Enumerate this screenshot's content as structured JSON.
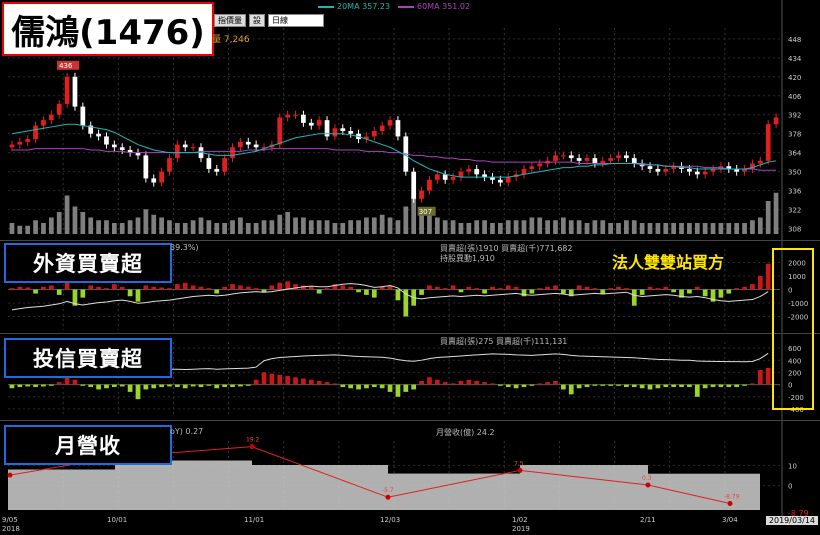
{
  "title": "儒鴻(1476)",
  "toolbar": {
    "b1": "指價量",
    "b2": "設",
    "period": "日線"
  },
  "legend": {
    "ma20": "20MA 357.23",
    "ma60": "60MA 351.02",
    "ma20_color": "#1fb5b5",
    "ma60_color": "#b040c0"
  },
  "volume_text": "量 7,246",
  "labels": {
    "foreign": "外資買賣超",
    "trust": "投信買賣超",
    "revenue": "月營收"
  },
  "annotation": "法人雙雙站買方",
  "foreign_info": {
    "pct": "39.3%)",
    "line1": "買賣超(張)1910 買賣超(千)771,682",
    "line2": "持股異動1,910"
  },
  "trust_info": {
    "line1": "買賣超(張)275 買賣超(千)111,131"
  },
  "rev_info": {
    "yoy": "oY) 0.27",
    "rev": "月營收(億) 24.2"
  },
  "price_peak_label": "436",
  "price_low_label": "307",
  "last_value": "-8.79",
  "date_label": "2019/03/14",
  "x_ticks": [
    {
      "label": "9/05",
      "sub": "2018",
      "x": 10
    },
    {
      "label": "10/01",
      "sub": "",
      "x": 115
    },
    {
      "label": "11/01",
      "sub": "",
      "x": 252
    },
    {
      "label": "12/03",
      "sub": "",
      "x": 388
    },
    {
      "label": "1/02",
      "sub": "2019",
      "x": 520
    },
    {
      "label": "2/11",
      "sub": "",
      "x": 648
    },
    {
      "label": "3/04",
      "sub": "",
      "x": 730
    }
  ],
  "colors": {
    "up": "#e02020",
    "down": "#ffffff",
    "foreign_pos": "#c81818",
    "foreign_neg": "#9bd42a",
    "volume": "#7f7f7f"
  },
  "chart_data": [
    {
      "type": "candlestick",
      "title": "儒鴻(1476)",
      "yticks": [
        308,
        322,
        336,
        350,
        364,
        378,
        392,
        406,
        420,
        434,
        448
      ],
      "ylim": [
        304,
        456
      ],
      "close": [
        370,
        372,
        374,
        384,
        388,
        392,
        400,
        420,
        398,
        384,
        378,
        376,
        370,
        368,
        366,
        364,
        362,
        345,
        342,
        350,
        360,
        370,
        368,
        368,
        360,
        352,
        350,
        360,
        368,
        372,
        370,
        368,
        368,
        370,
        390,
        392,
        392,
        386,
        384,
        388,
        376,
        382,
        380,
        378,
        374,
        376,
        380,
        384,
        388,
        376,
        350,
        330,
        336,
        344,
        348,
        344,
        346,
        350,
        352,
        348,
        346,
        344,
        342,
        346,
        348,
        352,
        354,
        356,
        358,
        362,
        362,
        360,
        358,
        360,
        356,
        358,
        360,
        362,
        360,
        356,
        354,
        352,
        350,
        352,
        354,
        352,
        350,
        348,
        350,
        352,
        354,
        352,
        350,
        352,
        356,
        358,
        385,
        390
      ],
      "ma20": [
        378,
        379,
        380,
        381,
        382,
        383,
        384,
        385,
        385,
        384,
        383,
        382,
        381,
        379,
        376,
        373,
        370,
        368,
        366,
        365,
        364,
        364,
        364,
        364,
        364,
        363,
        362,
        362,
        362,
        363,
        364,
        365,
        367,
        369,
        371,
        373,
        375,
        376,
        377,
        378,
        378,
        378,
        378,
        377,
        376,
        374,
        372,
        370,
        368,
        365,
        362,
        358,
        355,
        352,
        350,
        348,
        347,
        346,
        346,
        346,
        346,
        346,
        346,
        346,
        347,
        348,
        349,
        350,
        351,
        352,
        353,
        353,
        354,
        354,
        355,
        355,
        356,
        356,
        356,
        356,
        356,
        355,
        355,
        354,
        354,
        353,
        353,
        352,
        352,
        352,
        352,
        352,
        352,
        352,
        353,
        355,
        357,
        358
      ],
      "ma60": [
        366,
        366,
        366,
        367,
        367,
        367,
        367,
        367,
        367,
        367,
        366,
        366,
        365,
        365,
        365,
        364,
        364,
        364,
        364,
        364,
        364,
        364,
        364,
        364,
        365,
        365,
        365,
        365,
        365,
        365,
        366,
        366,
        366,
        367,
        367,
        367,
        367,
        367,
        367,
        367,
        367,
        366,
        366,
        366,
        366,
        365,
        365,
        365,
        364,
        364,
        363,
        362,
        362,
        361,
        361,
        360,
        360,
        359,
        359,
        358,
        358,
        357,
        357,
        357,
        357,
        357,
        357,
        357,
        357,
        357,
        357,
        357,
        356,
        356,
        356,
        356,
        356,
        356,
        356,
        356,
        355,
        355,
        355,
        354,
        354,
        354,
        354,
        354,
        353,
        353,
        353,
        352,
        352,
        352,
        352,
        351,
        351,
        351
      ],
      "volume": [
        4,
        3,
        3,
        5,
        4,
        6,
        8,
        14,
        10,
        8,
        6,
        5,
        5,
        4,
        4,
        5,
        6,
        9,
        7,
        6,
        5,
        4,
        4,
        5,
        6,
        5,
        4,
        4,
        5,
        6,
        4,
        4,
        5,
        5,
        7,
        8,
        6,
        6,
        5,
        5,
        5,
        4,
        4,
        5,
        5,
        6,
        6,
        7,
        6,
        5,
        10,
        16,
        9,
        8,
        6,
        5,
        5,
        4,
        4,
        5,
        5,
        4,
        4,
        5,
        5,
        5,
        6,
        6,
        5,
        5,
        6,
        5,
        5,
        4,
        5,
        5,
        4,
        4,
        5,
        5,
        4,
        4,
        4,
        4,
        4,
        4,
        4,
        4,
        4,
        4,
        4,
        4,
        4,
        4,
        5,
        6,
        12,
        15
      ]
    },
    {
      "type": "bar",
      "title": "外資買賣超",
      "yticks": [
        2000,
        1000,
        0,
        -1000,
        -2000
      ],
      "ylim": [
        -3000,
        3000
      ],
      "values": [
        100,
        200,
        150,
        -300,
        200,
        300,
        -400,
        500,
        -1200,
        -600,
        300,
        200,
        100,
        400,
        200,
        -500,
        -900,
        300,
        200,
        150,
        100,
        400,
        500,
        300,
        200,
        100,
        -300,
        200,
        400,
        300,
        200,
        100,
        -200,
        300,
        500,
        600,
        400,
        300,
        200,
        -300,
        100,
        400,
        300,
        200,
        -200,
        -400,
        -600,
        200,
        300,
        -800,
        -2000,
        -1200,
        -400,
        300,
        200,
        100,
        300,
        -200,
        200,
        100,
        -300,
        200,
        100,
        300,
        200,
        -500,
        -300,
        100,
        200,
        300,
        -300,
        -500,
        300,
        200,
        100,
        -300,
        100,
        200,
        100,
        -1200,
        -400,
        200,
        100,
        200,
        -200,
        -600,
        -300,
        200,
        -500,
        -900,
        -600,
        -300,
        100,
        200,
        400,
        1000,
        1910
      ],
      "line": [
        -400,
        -380,
        -360,
        -350,
        -340,
        -320,
        -300,
        -260,
        -300,
        -320,
        -300,
        -280,
        -270,
        -250,
        -240,
        -260,
        -290,
        -280,
        -260,
        -250,
        -240,
        -220,
        -200,
        -180,
        -170,
        -160,
        -170,
        -160,
        -140,
        -120,
        -110,
        -100,
        -110,
        -100,
        -80,
        -60,
        -40,
        -20,
        -10,
        -20,
        -20,
        0,
        20,
        30,
        20,
        0,
        -30,
        -20,
        0,
        -40,
        -140,
        -200,
        -220,
        -200,
        -190,
        -180,
        -170,
        -180,
        -170,
        -160,
        -170,
        -160,
        -150,
        -140,
        -130,
        -150,
        -160,
        -150,
        -140,
        -130,
        -140,
        -160,
        -150,
        -140,
        -130,
        -140,
        -130,
        -120,
        -110,
        -160,
        -180,
        -170,
        -160,
        -150,
        -160,
        -180,
        -190,
        -180,
        -200,
        -230,
        -250,
        -260,
        -250,
        -240,
        -230,
        -180,
        -100
      ]
    },
    {
      "type": "bar",
      "title": "投信買賣超",
      "yticks": [
        600,
        400,
        200,
        0,
        -200,
        -400
      ],
      "ylim": [
        -500,
        700
      ],
      "values": [
        -60,
        -40,
        -30,
        -40,
        -30,
        -20,
        40,
        120,
        80,
        -20,
        -40,
        -80,
        -60,
        -40,
        -30,
        -120,
        -240,
        -80,
        -60,
        -40,
        -30,
        -40,
        -60,
        -30,
        -40,
        -20,
        -60,
        -40,
        -40,
        -30,
        -20,
        80,
        200,
        180,
        160,
        140,
        120,
        100,
        80,
        60,
        40,
        20,
        -40,
        -60,
        -80,
        -60,
        -40,
        -60,
        -120,
        -200,
        -120,
        -80,
        60,
        120,
        80,
        40,
        20,
        60,
        80,
        60,
        40,
        20,
        -20,
        -40,
        -60,
        -40,
        -20,
        20,
        40,
        60,
        -80,
        -160,
        -60,
        -40,
        -20,
        -20,
        -20,
        -20,
        -40,
        -40,
        -60,
        -80,
        -60,
        -40,
        -40,
        -40,
        -40,
        -200,
        -60,
        -40,
        -40,
        -40,
        -40,
        -20,
        20,
        240,
        275
      ],
      "line": [
        100,
        110,
        120,
        115,
        110,
        105,
        100,
        110,
        120,
        115,
        110,
        100,
        95,
        100,
        105,
        100,
        80,
        85,
        90,
        95,
        100,
        100,
        95,
        100,
        105,
        110,
        100,
        105,
        110,
        115,
        120,
        140,
        260,
        300,
        320,
        330,
        340,
        350,
        355,
        360,
        365,
        370,
        360,
        350,
        340,
        335,
        330,
        325,
        310,
        280,
        260,
        250,
        270,
        300,
        320,
        330,
        340,
        350,
        360,
        370,
        380,
        390,
        385,
        380,
        370,
        365,
        360,
        370,
        380,
        390,
        380,
        360,
        350,
        345,
        340,
        335,
        330,
        325,
        320,
        315,
        305,
        295,
        285,
        280,
        275,
        270,
        268,
        255,
        250,
        248,
        246,
        244,
        242,
        240,
        245,
        300,
        400
      ]
    },
    {
      "type": "line",
      "title": "月營收",
      "categories": [
        "9月",
        "10月",
        "11月",
        "12月",
        "1月",
        "2月",
        "3月"
      ],
      "series": [
        {
          "name": "YoY",
          "values": [
            5.2,
            14,
            19.2,
            -5.7,
            7.5,
            0.3,
            -8.79
          ]
        }
      ],
      "bar_series": [
        {
          "name": "月營收(億)",
          "values": [
            27,
            33,
            30,
            24.3,
            30,
            24.2,
            24.2
          ]
        }
      ],
      "yticks": [
        10,
        0
      ],
      "data_labels": [
        "",
        "",
        "19.2",
        "-5.7",
        "7.5",
        "0.3",
        "-8.79"
      ]
    }
  ]
}
